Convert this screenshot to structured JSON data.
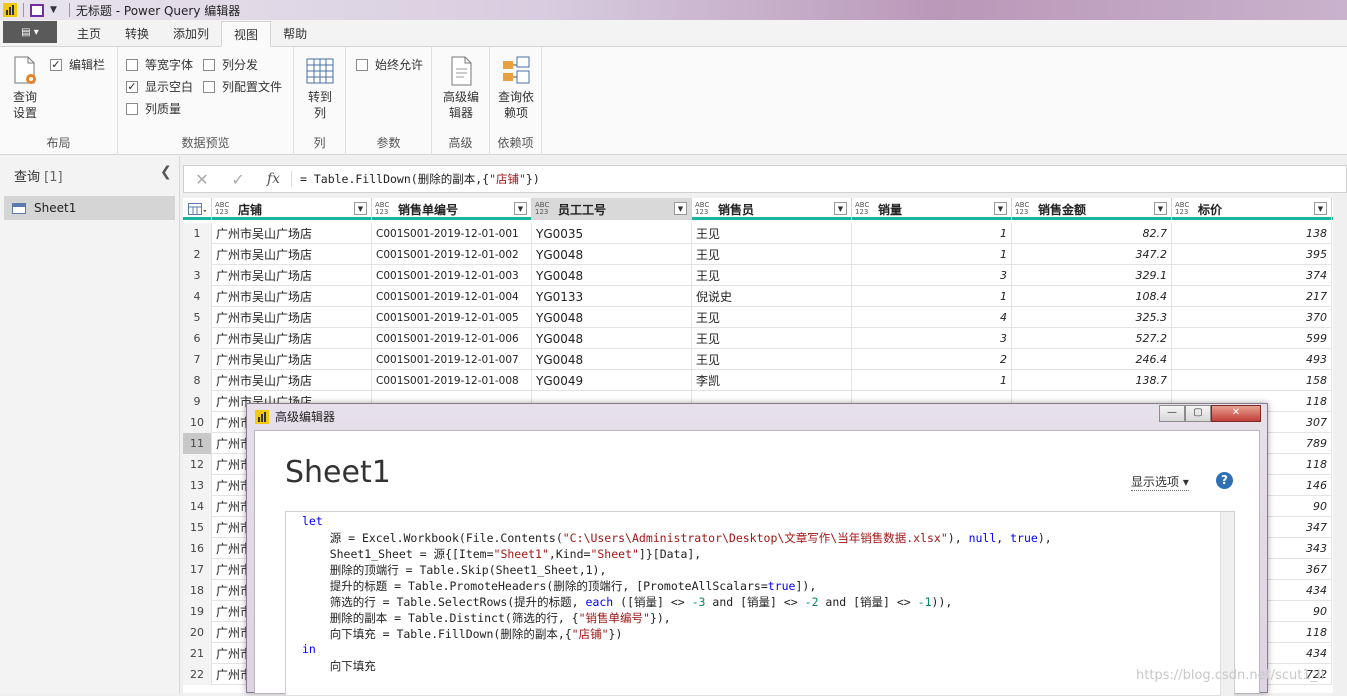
{
  "titlebar": {
    "title": "无标题 - Power Query 编辑器"
  },
  "tabs": [
    {
      "label": "主页"
    },
    {
      "label": "转换"
    },
    {
      "label": "添加列"
    },
    {
      "label": "视图"
    },
    {
      "label": "帮助"
    }
  ],
  "ribbon": {
    "layout": {
      "query_settings": "查询\n设置",
      "formula_bar": "编辑栏",
      "group": "布局"
    },
    "preview": {
      "monospace": "等宽字体",
      "show_whitespace": "显示空白",
      "column_quality": "列质量",
      "column_distribution": "列分发",
      "column_profile": "列配置文件",
      "group": "数据预览"
    },
    "columns": {
      "goto_column": "转到\n列",
      "group": "列"
    },
    "params": {
      "always_allow": "始终允许",
      "group": "参数"
    },
    "advanced": {
      "advanced_editor": "高级编\n辑器",
      "group": "高级"
    },
    "deps": {
      "query_deps": "查询依\n赖项",
      "group": "依赖项"
    }
  },
  "queries": {
    "title": "查询",
    "count": "[1]",
    "item": "Sheet1"
  },
  "formula": {
    "prefix": "= Table.FillDown(删除的副本,{",
    "str": "\"店铺\"",
    "suffix": "})"
  },
  "grid": {
    "type_abc": "ABC",
    "type_123": "123",
    "columns": [
      "店铺",
      "销售单编号",
      "员工工号",
      "销售员",
      "销量",
      "销售金额",
      "标价"
    ],
    "rows": [
      [
        "1",
        "广州市吴山广场店",
        "C001S001-2019-12-01-001",
        "YG0035",
        "王见",
        "1",
        "82.7",
        "138"
      ],
      [
        "2",
        "广州市吴山广场店",
        "C001S001-2019-12-01-002",
        "YG0048",
        "王见",
        "1",
        "347.2",
        "395"
      ],
      [
        "3",
        "广州市吴山广场店",
        "C001S001-2019-12-01-003",
        "YG0048",
        "王见",
        "3",
        "329.1",
        "374"
      ],
      [
        "4",
        "广州市吴山广场店",
        "C001S001-2019-12-01-004",
        "YG0133",
        "倪说史",
        "1",
        "108.4",
        "217"
      ],
      [
        "5",
        "广州市吴山广场店",
        "C001S001-2019-12-01-005",
        "YG0048",
        "王见",
        "4",
        "325.3",
        "370"
      ],
      [
        "6",
        "广州市吴山广场店",
        "C001S001-2019-12-01-006",
        "YG0048",
        "王见",
        "3",
        "527.2",
        "599"
      ],
      [
        "7",
        "广州市吴山广场店",
        "C001S001-2019-12-01-007",
        "YG0048",
        "王见",
        "2",
        "246.4",
        "493"
      ],
      [
        "8",
        "广州市吴山广场店",
        "C001S001-2019-12-01-008",
        "YG0049",
        "李凯",
        "1",
        "138.7",
        "158"
      ],
      [
        "9",
        "广州市吴山广场店",
        "",
        "",
        "",
        "",
        "",
        "118"
      ],
      [
        "10",
        "广州市",
        "",
        "",
        "",
        "",
        "",
        "307"
      ],
      [
        "11",
        "广州市",
        "",
        "",
        "",
        "",
        "",
        "789"
      ],
      [
        "12",
        "广州市",
        "",
        "",
        "",
        "",
        "",
        "118"
      ],
      [
        "13",
        "广州市",
        "",
        "",
        "",
        "",
        "",
        "146"
      ],
      [
        "14",
        "广州市",
        "",
        "",
        "",
        "",
        "",
        "90"
      ],
      [
        "15",
        "广州市",
        "",
        "",
        "",
        "",
        "",
        "347"
      ],
      [
        "16",
        "广州市",
        "",
        "",
        "",
        "",
        "",
        "343"
      ],
      [
        "17",
        "广州市",
        "",
        "",
        "",
        "",
        "",
        "367"
      ],
      [
        "18",
        "广州市",
        "",
        "",
        "",
        "",
        "",
        "434"
      ],
      [
        "19",
        "广州市",
        "",
        "",
        "",
        "",
        "",
        "90"
      ],
      [
        "20",
        "广州市",
        "",
        "",
        "",
        "",
        "",
        "118"
      ],
      [
        "21",
        "广州市",
        "",
        "",
        "",
        "",
        "",
        "434"
      ],
      [
        "22",
        "广州市",
        "",
        "",
        "",
        "",
        "",
        "722"
      ]
    ]
  },
  "modal": {
    "title": "高级编辑器",
    "heading": "Sheet1",
    "display_options": "显示选项",
    "help": "?",
    "code": {
      "l1": "let",
      "l2a": "    源 = Excel.Workbook(File.Contents(",
      "l2s": "\"C:\\Users\\Administrator\\Desktop\\文章写作\\当年销售数据.xlsx\"",
      "l2b": "), ",
      "l2n": "null",
      "l2c": ", ",
      "l2t": "true",
      "l2d": "),",
      "l3a": "    Sheet1_Sheet = 源{[Item=",
      "l3s1": "\"Sheet1\"",
      "l3b": ",Kind=",
      "l3s2": "\"Sheet\"",
      "l3c": "]}[Data],",
      "l4": "    删除的顶端行 = Table.Skip(Sheet1_Sheet,1),",
      "l5a": "    提升的标题 = Table.PromoteHeaders(删除的顶端行, [PromoteAllScalars=",
      "l5t": "true",
      "l5b": "]),",
      "l6a": "    筛选的行 = Table.SelectRows(提升的标题, ",
      "l6k": "each",
      "l6b": " ([销量] <> ",
      "l6n1": "-3",
      "l6c": " and [销量] <> ",
      "l6n2": "-2",
      "l6d": " and [销量] <> ",
      "l6n3": "-1",
      "l6e": ")),",
      "l7a": "    删除的副本 = Table.Distinct(筛选的行, {",
      "l7s": "\"销售单编号\"",
      "l7b": "}),",
      "l8a": "    向下填充 = Table.FillDown(删除的副本,{",
      "l8s": "\"店铺\"",
      "l8b": "})",
      "l9": "in",
      "l10": "    向下填充"
    }
  },
  "watermark": "https://blog.csdn.net/scut1_li"
}
